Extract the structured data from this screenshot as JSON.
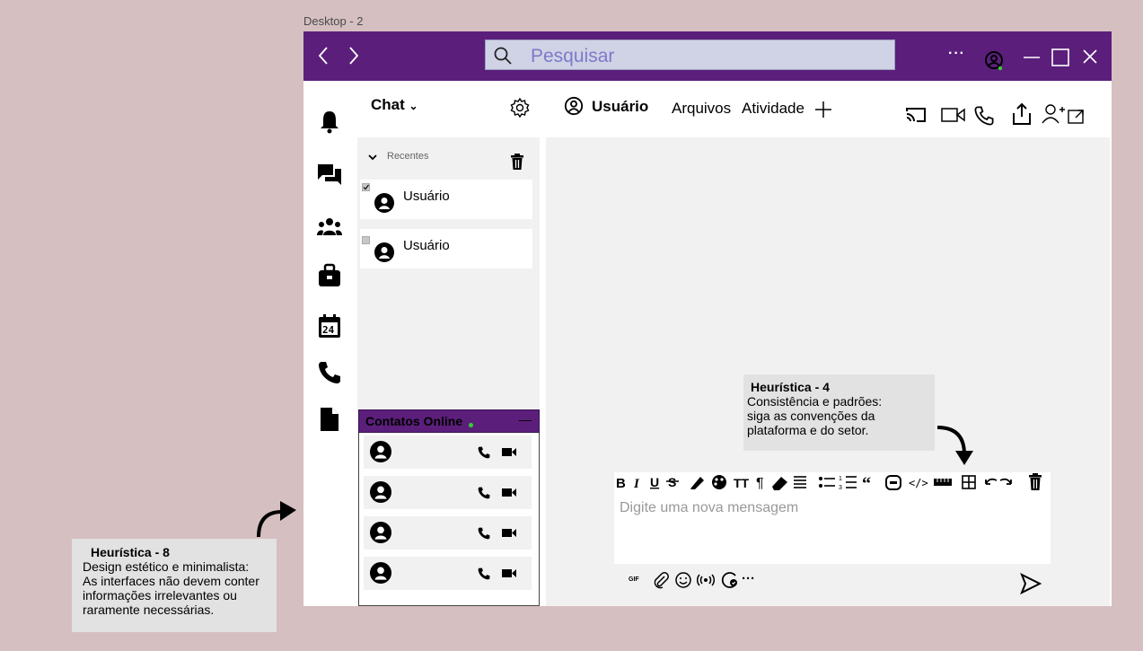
{
  "frame_label": "Desktop - 2",
  "search": {
    "placeholder": "Pesquisar"
  },
  "chat_panel": {
    "title": "Chat",
    "recents_label": "Recentes",
    "users": [
      {
        "name": "Usuário",
        "checked": true
      },
      {
        "name": "Usuário",
        "checked": false
      }
    ]
  },
  "online": {
    "title": "Contatos Online",
    "minimize": "—",
    "contacts": [
      {},
      {},
      {},
      {}
    ]
  },
  "header": {
    "user_tab": "Usuário",
    "files_tab": "Arquivos",
    "activity_tab": "Atividade",
    "add": "+"
  },
  "compose": {
    "placeholder": "Digite uma nova mensagem",
    "gif": "GIF",
    "more": "···"
  },
  "notes": {
    "h4": {
      "title": "Heurística  - 4",
      "lines": [
        "Consistência e padrões:",
        "siga as convenções da",
        "plataforma e do setor."
      ]
    },
    "h8": {
      "title": "Heurística  -  8",
      "lines": [
        "Design estético e minimalista:",
        "As interfaces não devem conter",
        "informações irrelevantes ou",
        "raramente necessárias."
      ]
    }
  },
  "colors": {
    "titlebar": "#5b1f7b",
    "online_dot": "#33d033",
    "search_bg": "#cfd3e5"
  }
}
